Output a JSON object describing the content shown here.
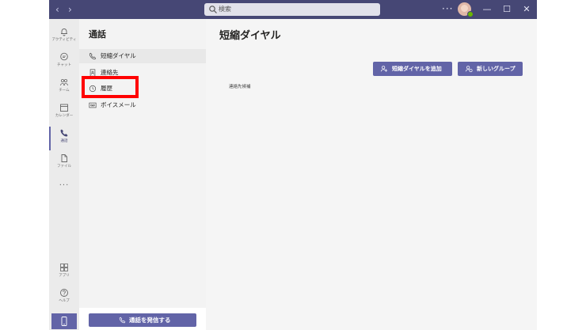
{
  "titlebar": {
    "back_glyph": "‹",
    "forward_glyph": "›",
    "search_placeholder": "検索",
    "more_glyph": "···",
    "minimize_glyph": "—",
    "maximize_glyph": "☐",
    "close_glyph": "✕"
  },
  "rail": {
    "items": [
      {
        "label": "アクティビティ",
        "icon": "bell-icon"
      },
      {
        "label": "チャット",
        "icon": "chat-icon"
      },
      {
        "label": "チーム",
        "icon": "teams-icon"
      },
      {
        "label": "カレンダー",
        "icon": "calendar-icon"
      },
      {
        "label": "通話",
        "icon": "phone-icon",
        "active": true
      },
      {
        "label": "ファイル",
        "icon": "file-icon"
      }
    ],
    "more_glyph": "···",
    "apps_label": "アプリ",
    "help_label": "ヘルプ"
  },
  "panel": {
    "title": "通話",
    "items": [
      {
        "label": "短縮ダイヤル",
        "icon": "phone-icon",
        "selected": true
      },
      {
        "label": "連絡先",
        "icon": "contact-card-icon"
      },
      {
        "label": "履歴",
        "icon": "clock-icon"
      },
      {
        "label": "ボイスメール",
        "icon": "voicemail-icon"
      }
    ],
    "call_button_label": "通話を発信する"
  },
  "main": {
    "title": "短縮ダイヤル",
    "add_speed_dial_label": "短縮ダイヤルを追加",
    "new_group_label": "新しいグループ",
    "empty_text": "連絡先候補"
  },
  "colors": {
    "titlebar": "#464775",
    "accent": "#6264a7",
    "highlight": "#ff0000",
    "rail_bg": "#ebebeb",
    "panel_bg": "#f3f3f3",
    "main_bg": "#f5f5f5"
  }
}
